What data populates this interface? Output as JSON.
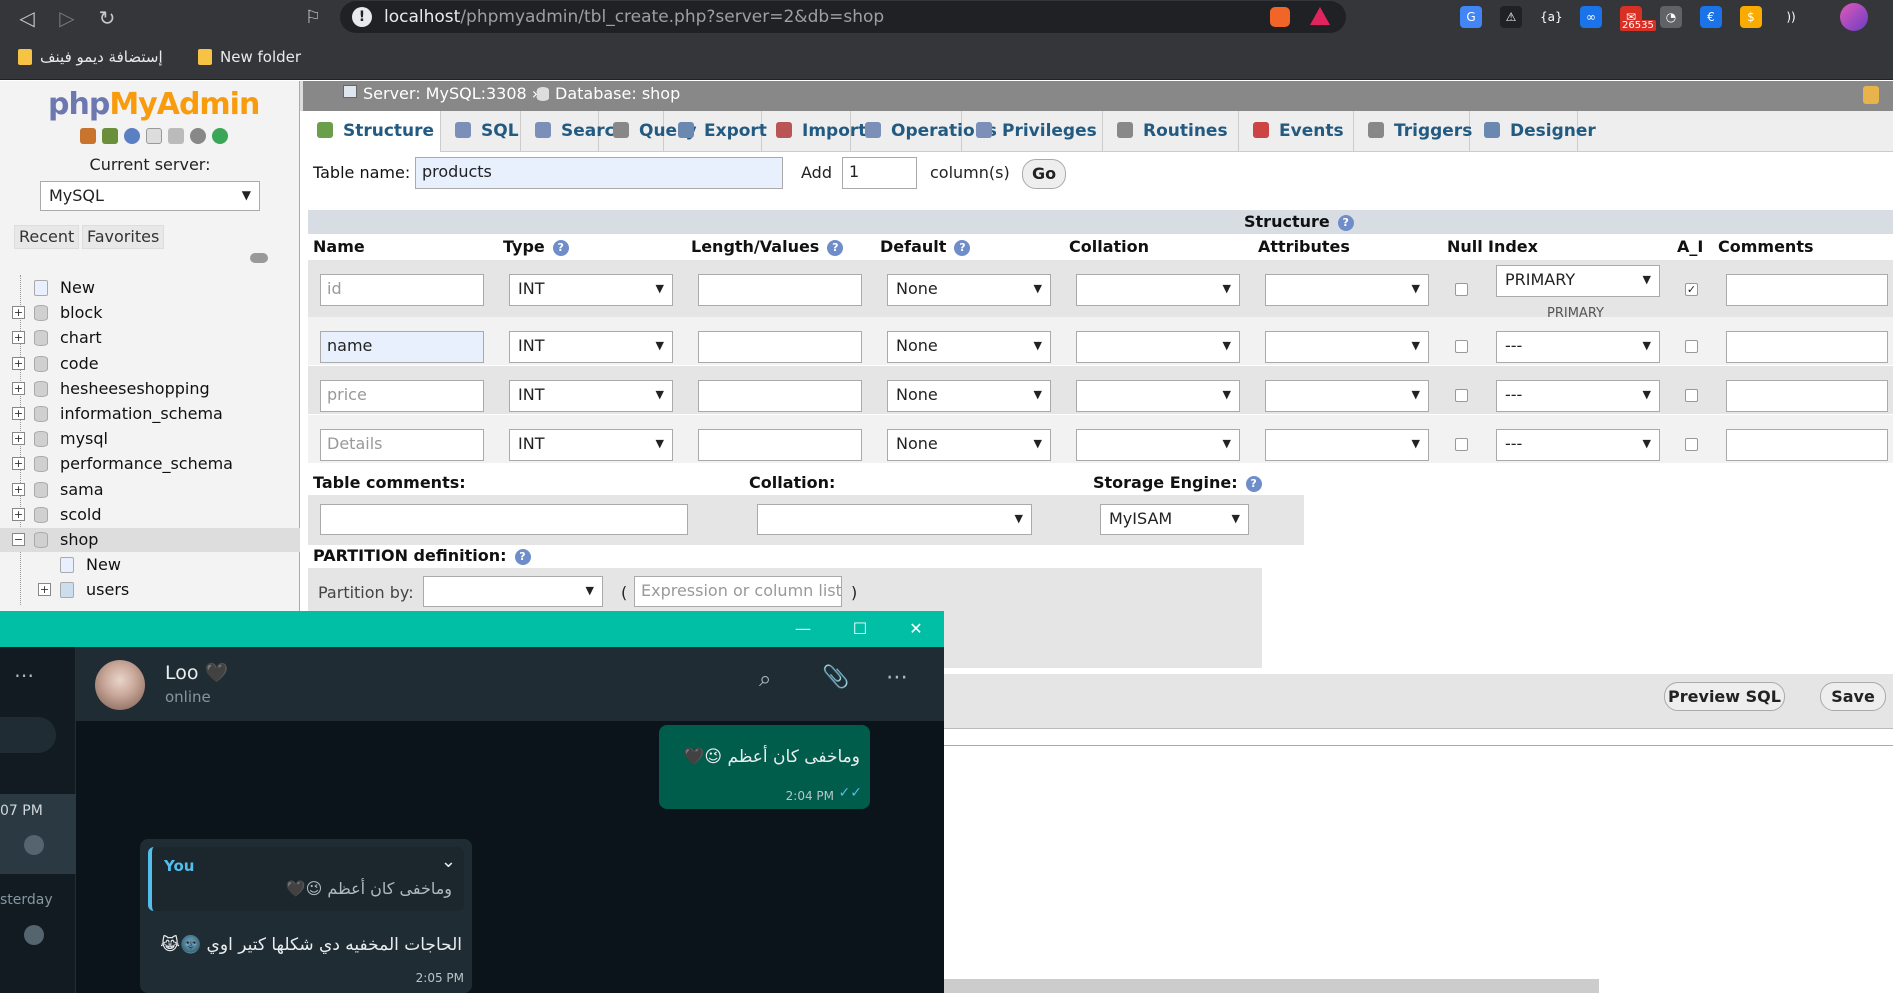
{
  "browser": {
    "url_host": "localhost",
    "url_path": "/phpmyadmin/tbl_create.php?server=2&db=shop",
    "info_icon": "!",
    "extensions": [
      {
        "name": "translate-icon",
        "color": "#4285f4",
        "text": "G"
      },
      {
        "name": "warning-icon",
        "color": "#202124",
        "text": "⚠"
      },
      {
        "name": "code-icon",
        "color": "#35363a",
        "text": "{a}"
      },
      {
        "name": "infinity-icon",
        "color": "#1a73e8",
        "text": "∞"
      },
      {
        "name": "mail-icon",
        "color": "#d93025",
        "text": "✉"
      },
      {
        "name": "gauge-icon",
        "color": "#5f6368",
        "text": "◔"
      },
      {
        "name": "euro-icon",
        "color": "#1a73e8",
        "text": "€"
      },
      {
        "name": "dollar-icon",
        "color": "#f9ab00",
        "text": "$"
      },
      {
        "name": "wave-icon",
        "color": "#35363a",
        "text": "))"
      }
    ],
    "mail_badge": "26535",
    "bookmarks": [
      {
        "label": "إستضافة ديمو فينف"
      },
      {
        "label": "New folder"
      }
    ]
  },
  "pma": {
    "logo_php": "php",
    "logo_my": "MyAdmin",
    "current_server_label": "Current server:",
    "server_value": "MySQL",
    "recent_tab": "Recent",
    "favorites_tab": "Favorites",
    "tree": [
      {
        "label": "New",
        "top": 0
      },
      {
        "label": "block"
      },
      {
        "label": "chart"
      },
      {
        "label": "code"
      },
      {
        "label": "hesheeseshopping"
      },
      {
        "label": "information_schema"
      },
      {
        "label": "mysql"
      },
      {
        "label": "performance_schema"
      },
      {
        "label": "sama"
      },
      {
        "label": "scold"
      },
      {
        "label": "shop"
      },
      {
        "label": "New"
      },
      {
        "label": "users"
      }
    ],
    "breadcrumb_server": "Server: MySQL:3308 »",
    "breadcrumb_db": "Database: shop",
    "tabs": [
      "Structure",
      "SQL",
      "Search",
      "Query",
      "Export",
      "Import",
      "Operations",
      "Privileges",
      "Routines",
      "Events",
      "Triggers",
      "Designer"
    ],
    "table_name_label": "Table name:",
    "table_name_value": "products",
    "add_label": "Add",
    "add_value": "1",
    "columns_label": "column(s)",
    "go_label": "Go",
    "structure_header": "Structure",
    "col_headers": {
      "name": "Name",
      "type": "Type",
      "length": "Length/Values",
      "default": "Default",
      "collation": "Collation",
      "attributes": "Attributes",
      "null": "Null",
      "index": "Index",
      "ai": "A_I",
      "comments": "Comments"
    },
    "rows": [
      {
        "name": "id",
        "name_placeholder": true,
        "type": "INT",
        "default": "None",
        "index": "PRIMARY",
        "index_note": "PRIMARY",
        "ai": true
      },
      {
        "name": "name",
        "name_placeholder": false,
        "type": "INT",
        "default": "None",
        "index": "---",
        "ai": false
      },
      {
        "name": "price",
        "name_placeholder": true,
        "type": "INT",
        "default": "None",
        "index": "---",
        "ai": false
      },
      {
        "name": "Details",
        "name_placeholder": true,
        "type": "INT",
        "default": "None",
        "index": "---",
        "ai": false
      }
    ],
    "table_comments_label": "Table comments:",
    "collation_label": "Collation:",
    "storage_engine_label": "Storage Engine:",
    "storage_engine_value": "MyISAM",
    "partition_label": "PARTITION definition:",
    "partition_by_label": "Partition by:",
    "partition_paren_open": "(",
    "partition_paren_close": ")",
    "partition_expr_placeholder": "Expression or column list",
    "preview_sql": "Preview SQL",
    "save": "Save"
  },
  "whatsapp": {
    "contact_name": "Loo 🖤",
    "contact_status": "online",
    "left_times": [
      "07 PM",
      "sterday"
    ],
    "msg_out_text": "وماخفى كان أعظم 😉🖤",
    "msg_out_time": "2:04 PM",
    "reply_author": "You",
    "reply_quote": "وماخفى كان أعظم 😉🖤",
    "reply_text": "الحاجات المخفيه دي شكلها كتير اوي 🌚😹",
    "reply_time": "2:05 PM"
  },
  "colors": {
    "wa_accent": "#00bfa5",
    "pma_link": "#235a81",
    "outgoing_bubble": "#005c4b"
  }
}
